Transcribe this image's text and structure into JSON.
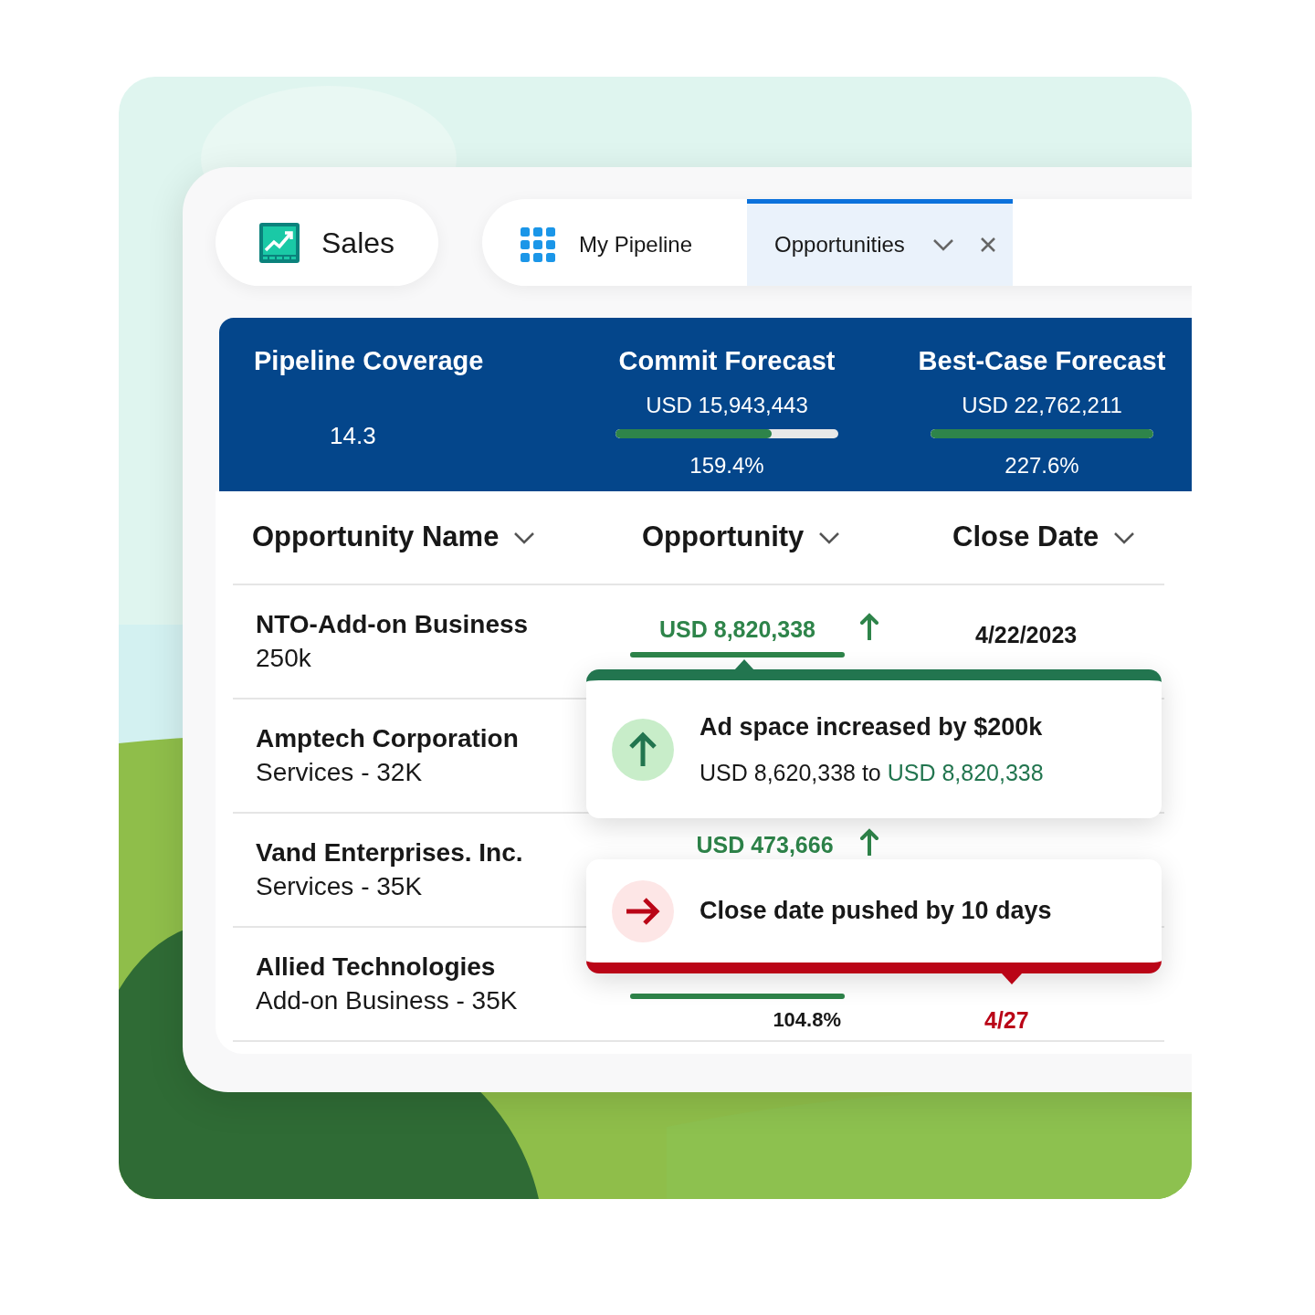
{
  "app": {
    "name": "Sales"
  },
  "tabs": [
    {
      "label": "My Pipeline",
      "kind": "home",
      "selected": false
    },
    {
      "label": "Opportunities",
      "kind": "record",
      "selected": true
    }
  ],
  "summary": {
    "metrics": [
      {
        "kind": "plain",
        "title": "Pipeline Coverage",
        "value": "14.3"
      },
      {
        "kind": "progress",
        "title": "Commit Forecast",
        "amount": "USD 15,943,443",
        "level": 0.7,
        "percent": "159.4%"
      },
      {
        "kind": "progress",
        "title": "Best-Case Forecast",
        "amount": "USD 22,762,211",
        "level": 1,
        "percent": "227.6%"
      }
    ]
  },
  "table": {
    "columns": [
      "Opportunity Name",
      "Opportunity",
      "Close Date"
    ],
    "rows": [
      {
        "name": "NTO-Add-on Business",
        "detail": "250k",
        "amount": "USD 8,820,338",
        "trend_up": true,
        "level": 1,
        "close_date": "4/22/2023",
        "date_changed": false
      },
      {
        "name": "Amptech Corporation",
        "detail": "Services - 32K"
      },
      {
        "name": "Vand Enterprises. Inc.",
        "detail": "Services - 35K",
        "amount": "USD 473,666",
        "trend_up": true
      },
      {
        "name": "Allied Technologies",
        "detail": "Add-on Business - 35K",
        "level": 1,
        "percent": "104.8%",
        "close_date": "4/27",
        "date_changed": true
      }
    ]
  },
  "alerts": [
    {
      "kind": "increase",
      "title": "Ad space increased by $200k",
      "detail": "USD 8,620,338 to",
      "new_value": "USD 8,820,338"
    },
    {
      "kind": "delay",
      "title": "Close date pushed by 10 days"
    }
  ]
}
